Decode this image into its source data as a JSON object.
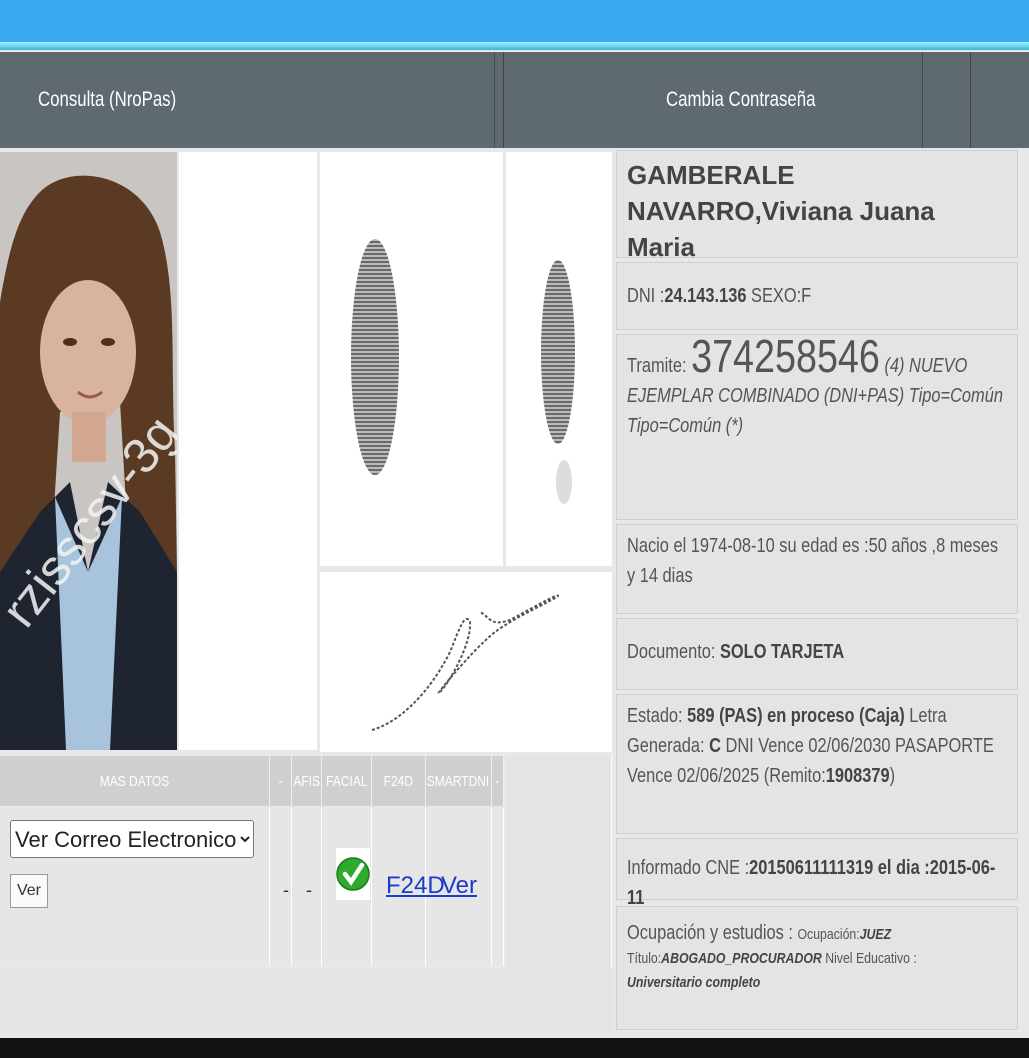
{
  "nav": {
    "consulta": "Consulta (NroPas)",
    "cambia": "Cambia Contraseña"
  },
  "photo": {
    "watermark": "rzisscsv-3g"
  },
  "person": {
    "name": "GAMBERALE NAVARRO,Viviana Juana Maria",
    "dni_label": "DNI :",
    "dni": "24.143.136",
    "sexo": " SEXO:F",
    "tramite_label": "Tramite: ",
    "tramite_number": "374258546",
    "tramite_desc": " (4) NUEVO EJEMPLAR COMBINADO (DNI+PAS) Tipo=Común Tipo=Común (*)",
    "nacio": "Nacio el 1974-08-10 su edad es :50 años ,8 meses y 14 dias",
    "documento_label": "Documento: ",
    "documento_value": "SOLO TARJETA",
    "estado_label": "Estado: ",
    "estado_value": "589 (PAS) en proceso (Caja)",
    "letra_label": " Letra Generada: ",
    "letra_value": "C",
    "vence": " DNI Vence 02/06/2030 PASAPORTE Vence 02/06/2025 (Remito:",
    "remito": "1908379",
    "remito_close": ")",
    "informado_label": "Informado CNE :",
    "informado_value": "20150611111319 el dia :2015-06-11",
    "ocupacion_label": "Ocupación y estudios : ",
    "ocupacion_small": "Ocupación:",
    "ocupacion_value": "JUEZ",
    "titulo_label": "Título:",
    "titulo_value": "ABOGADO_PROCURADOR",
    "nivel_label": " Nivel Educativo :",
    "nivel_value": "Universitario completo"
  },
  "masdatos": {
    "headers": [
      "MAS DATOS",
      "-",
      "AFIS",
      "FACIAL",
      "F24D",
      "SMARTDNI",
      "-"
    ],
    "select_value": "Ver Correo Electronico",
    "ver_button": "Ver",
    "afis_dash1": "-",
    "afis_dash2": "-",
    "f24d_link": "F24D",
    "smartdni_link": "Ver"
  },
  "colors": {
    "topbar": "#3aaaf0",
    "nav": "#5e6a70",
    "link": "#1a3cc8",
    "check": "#2eaa2e"
  }
}
